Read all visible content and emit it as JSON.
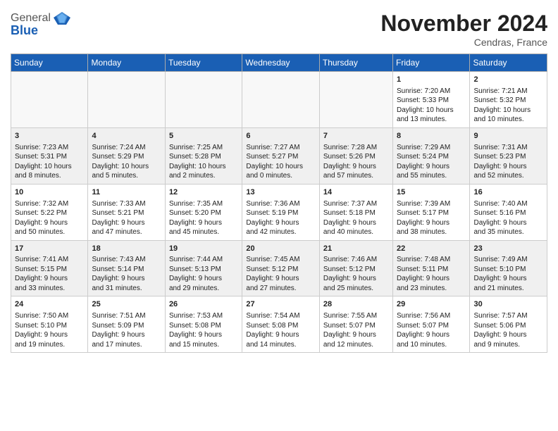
{
  "header": {
    "logo_line1": "General",
    "logo_line2": "Blue",
    "month_title": "November 2024",
    "location": "Cendras, France"
  },
  "days_of_week": [
    "Sunday",
    "Monday",
    "Tuesday",
    "Wednesday",
    "Thursday",
    "Friday",
    "Saturday"
  ],
  "weeks": [
    [
      {
        "day": "",
        "info": ""
      },
      {
        "day": "",
        "info": ""
      },
      {
        "day": "",
        "info": ""
      },
      {
        "day": "",
        "info": ""
      },
      {
        "day": "",
        "info": ""
      },
      {
        "day": "1",
        "info": "Sunrise: 7:20 AM\nSunset: 5:33 PM\nDaylight: 10 hours\nand 13 minutes."
      },
      {
        "day": "2",
        "info": "Sunrise: 7:21 AM\nSunset: 5:32 PM\nDaylight: 10 hours\nand 10 minutes."
      }
    ],
    [
      {
        "day": "3",
        "info": "Sunrise: 7:23 AM\nSunset: 5:31 PM\nDaylight: 10 hours\nand 8 minutes."
      },
      {
        "day": "4",
        "info": "Sunrise: 7:24 AM\nSunset: 5:29 PM\nDaylight: 10 hours\nand 5 minutes."
      },
      {
        "day": "5",
        "info": "Sunrise: 7:25 AM\nSunset: 5:28 PM\nDaylight: 10 hours\nand 2 minutes."
      },
      {
        "day": "6",
        "info": "Sunrise: 7:27 AM\nSunset: 5:27 PM\nDaylight: 10 hours\nand 0 minutes."
      },
      {
        "day": "7",
        "info": "Sunrise: 7:28 AM\nSunset: 5:26 PM\nDaylight: 9 hours\nand 57 minutes."
      },
      {
        "day": "8",
        "info": "Sunrise: 7:29 AM\nSunset: 5:24 PM\nDaylight: 9 hours\nand 55 minutes."
      },
      {
        "day": "9",
        "info": "Sunrise: 7:31 AM\nSunset: 5:23 PM\nDaylight: 9 hours\nand 52 minutes."
      }
    ],
    [
      {
        "day": "10",
        "info": "Sunrise: 7:32 AM\nSunset: 5:22 PM\nDaylight: 9 hours\nand 50 minutes."
      },
      {
        "day": "11",
        "info": "Sunrise: 7:33 AM\nSunset: 5:21 PM\nDaylight: 9 hours\nand 47 minutes."
      },
      {
        "day": "12",
        "info": "Sunrise: 7:35 AM\nSunset: 5:20 PM\nDaylight: 9 hours\nand 45 minutes."
      },
      {
        "day": "13",
        "info": "Sunrise: 7:36 AM\nSunset: 5:19 PM\nDaylight: 9 hours\nand 42 minutes."
      },
      {
        "day": "14",
        "info": "Sunrise: 7:37 AM\nSunset: 5:18 PM\nDaylight: 9 hours\nand 40 minutes."
      },
      {
        "day": "15",
        "info": "Sunrise: 7:39 AM\nSunset: 5:17 PM\nDaylight: 9 hours\nand 38 minutes."
      },
      {
        "day": "16",
        "info": "Sunrise: 7:40 AM\nSunset: 5:16 PM\nDaylight: 9 hours\nand 35 minutes."
      }
    ],
    [
      {
        "day": "17",
        "info": "Sunrise: 7:41 AM\nSunset: 5:15 PM\nDaylight: 9 hours\nand 33 minutes."
      },
      {
        "day": "18",
        "info": "Sunrise: 7:43 AM\nSunset: 5:14 PM\nDaylight: 9 hours\nand 31 minutes."
      },
      {
        "day": "19",
        "info": "Sunrise: 7:44 AM\nSunset: 5:13 PM\nDaylight: 9 hours\nand 29 minutes."
      },
      {
        "day": "20",
        "info": "Sunrise: 7:45 AM\nSunset: 5:12 PM\nDaylight: 9 hours\nand 27 minutes."
      },
      {
        "day": "21",
        "info": "Sunrise: 7:46 AM\nSunset: 5:12 PM\nDaylight: 9 hours\nand 25 minutes."
      },
      {
        "day": "22",
        "info": "Sunrise: 7:48 AM\nSunset: 5:11 PM\nDaylight: 9 hours\nand 23 minutes."
      },
      {
        "day": "23",
        "info": "Sunrise: 7:49 AM\nSunset: 5:10 PM\nDaylight: 9 hours\nand 21 minutes."
      }
    ],
    [
      {
        "day": "24",
        "info": "Sunrise: 7:50 AM\nSunset: 5:10 PM\nDaylight: 9 hours\nand 19 minutes."
      },
      {
        "day": "25",
        "info": "Sunrise: 7:51 AM\nSunset: 5:09 PM\nDaylight: 9 hours\nand 17 minutes."
      },
      {
        "day": "26",
        "info": "Sunrise: 7:53 AM\nSunset: 5:08 PM\nDaylight: 9 hours\nand 15 minutes."
      },
      {
        "day": "27",
        "info": "Sunrise: 7:54 AM\nSunset: 5:08 PM\nDaylight: 9 hours\nand 14 minutes."
      },
      {
        "day": "28",
        "info": "Sunrise: 7:55 AM\nSunset: 5:07 PM\nDaylight: 9 hours\nand 12 minutes."
      },
      {
        "day": "29",
        "info": "Sunrise: 7:56 AM\nSunset: 5:07 PM\nDaylight: 9 hours\nand 10 minutes."
      },
      {
        "day": "30",
        "info": "Sunrise: 7:57 AM\nSunset: 5:06 PM\nDaylight: 9 hours\nand 9 minutes."
      }
    ]
  ]
}
